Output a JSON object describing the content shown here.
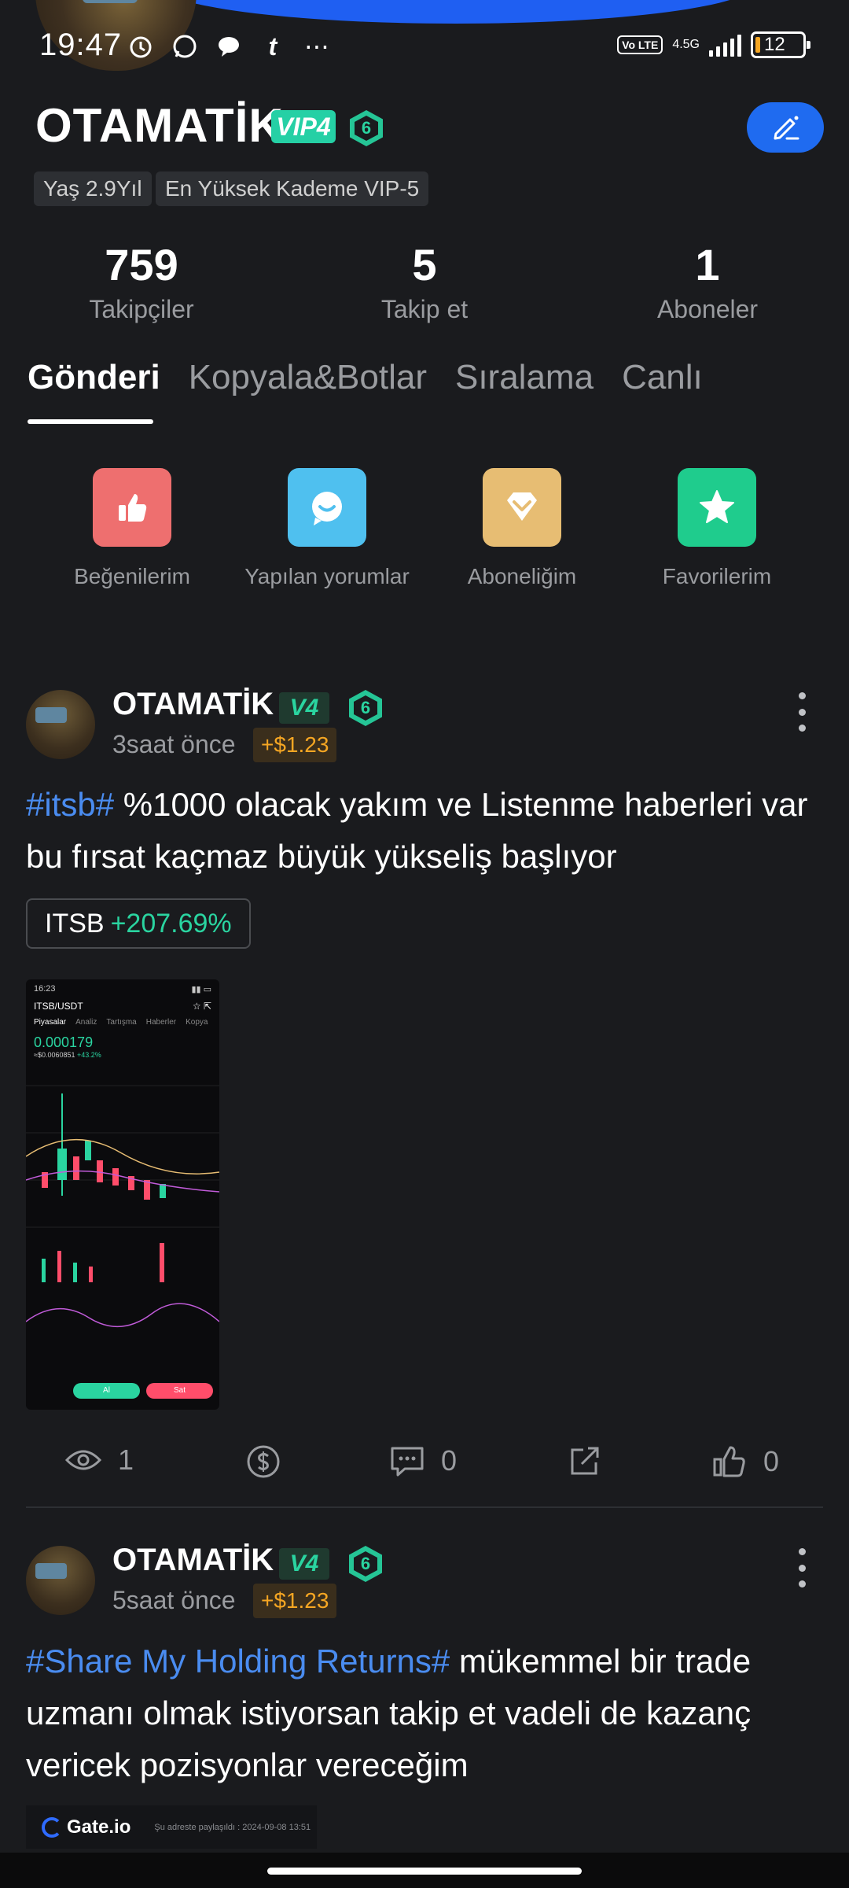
{
  "status_bar": {
    "time": "19:47",
    "network": "4.5G",
    "volte": "Vo LTE",
    "battery": "12"
  },
  "profile": {
    "name": "OTAMATİK",
    "vip": "VIP4",
    "level": "6",
    "tags": [
      "Yaş 2.9Yıl",
      "En Yüksek Kademe VIP-5"
    ],
    "stats": [
      {
        "value": "759",
        "label": "Takipçiler"
      },
      {
        "value": "5",
        "label": "Takip et"
      },
      {
        "value": "1",
        "label": "Aboneler"
      }
    ]
  },
  "tabs": [
    "Gönderi",
    "Kopyala&Botlar",
    "Sıralama",
    "Canlı"
  ],
  "quick_actions": [
    {
      "label": "Beğenilerim",
      "icon": "thumbs-up-icon",
      "color": "#ee6f6f"
    },
    {
      "label": "Yapılan yorumlar",
      "icon": "comment-smile-icon",
      "color": "#4fc0ef"
    },
    {
      "label": "Aboneliğim",
      "icon": "diamond-icon",
      "color": "#e7bd73"
    },
    {
      "label": "Favorilerim",
      "icon": "star-icon",
      "color": "#1fcc8d"
    }
  ],
  "posts": [
    {
      "author": "OTAMATİK",
      "badge": "V4",
      "level": "6",
      "time": "3saat önce",
      "gain": "+$1.23",
      "hashtag": "#itsb#",
      "text": " %1000 olacak yakım ve Listenme haberleri var bu fırsat kaçmaz büyük yükseliş başlıyor",
      "coin": {
        "symbol": "ITSB",
        "change": "+207.69%"
      },
      "screenshot": {
        "time": "16:23",
        "pair": "ITSB/USDT",
        "tabs": [
          "Piyasalar",
          "Analiz",
          "Tartışma",
          "Haberler",
          "Kopya"
        ],
        "price": "0.000179",
        "price_sub": "≈$0.0060851",
        "price_change": "+43.2%",
        "buy": "Al",
        "sell": "Sat"
      },
      "views": "1",
      "comments": "0",
      "likes": "0"
    },
    {
      "author": "OTAMATİK",
      "badge": "V4",
      "level": "6",
      "time": "5saat önce",
      "gain": "+$1.23",
      "hashtag": "#Share My Holding Returns#",
      "text": " mükemmel bir trade uzmanı olmak istiyorsan takip et vadeli de kazanç vericek pozisyonlar vereceğim",
      "preview": {
        "logo": "Gate.io",
        "note": "Şu adreste paylaşıldı : 2024-09-08 13:51"
      }
    }
  ]
}
